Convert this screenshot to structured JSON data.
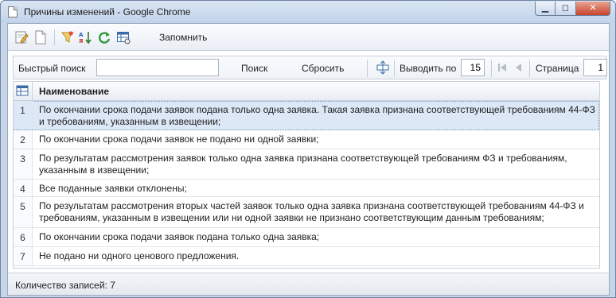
{
  "window": {
    "title": "Причины изменений - Google Chrome",
    "min_label": "▁",
    "max_label": "◻",
    "close_label": "✕"
  },
  "toolbar": {
    "icons": [
      "edit-icon",
      "new-document-icon",
      "filter-icon",
      "sort-icon",
      "refresh-icon",
      "table-settings-icon"
    ],
    "remember_label": "Запомнить"
  },
  "search": {
    "label": "Быстрый поиск",
    "value": "",
    "search_button": "Поиск",
    "reset_button": "Сбросить",
    "per_page_label": "Выводить по",
    "per_page_value": "15",
    "page_label": "Страница",
    "page_value": "1"
  },
  "grid": {
    "column": "Наименование",
    "rows": [
      {
        "num": "1",
        "text": "По окончании срока подачи заявок подана только одна заявка. Такая заявка признана соответствующей требованиям 44-ФЗ и требованиям, указанным в извещении;"
      },
      {
        "num": "2",
        "text": "По окончании срока подачи заявок не подано ни одной заявки;"
      },
      {
        "num": "3",
        "text": "По результатам рассмотрения заявок только одна заявка признана соответствующей требованиям ФЗ и требованиям, указанным в извещении;"
      },
      {
        "num": "4",
        "text": "Все поданные заявки отклонены;"
      },
      {
        "num": "5",
        "text": "По результатам рассмотрения вторых частей заявок только одна заявка признана соответствующей требованиям 44-ФЗ и требованиям, указанным в извещении или ни одной заявки не признано соответствующим данным требованиям;"
      },
      {
        "num": "6",
        "text": "По окончании срока подачи заявок подана только одна заявка;"
      },
      {
        "num": "7",
        "text": "Не подано ни одного ценового предложения."
      }
    ]
  },
  "status": {
    "text": "Количество записей: 7"
  }
}
